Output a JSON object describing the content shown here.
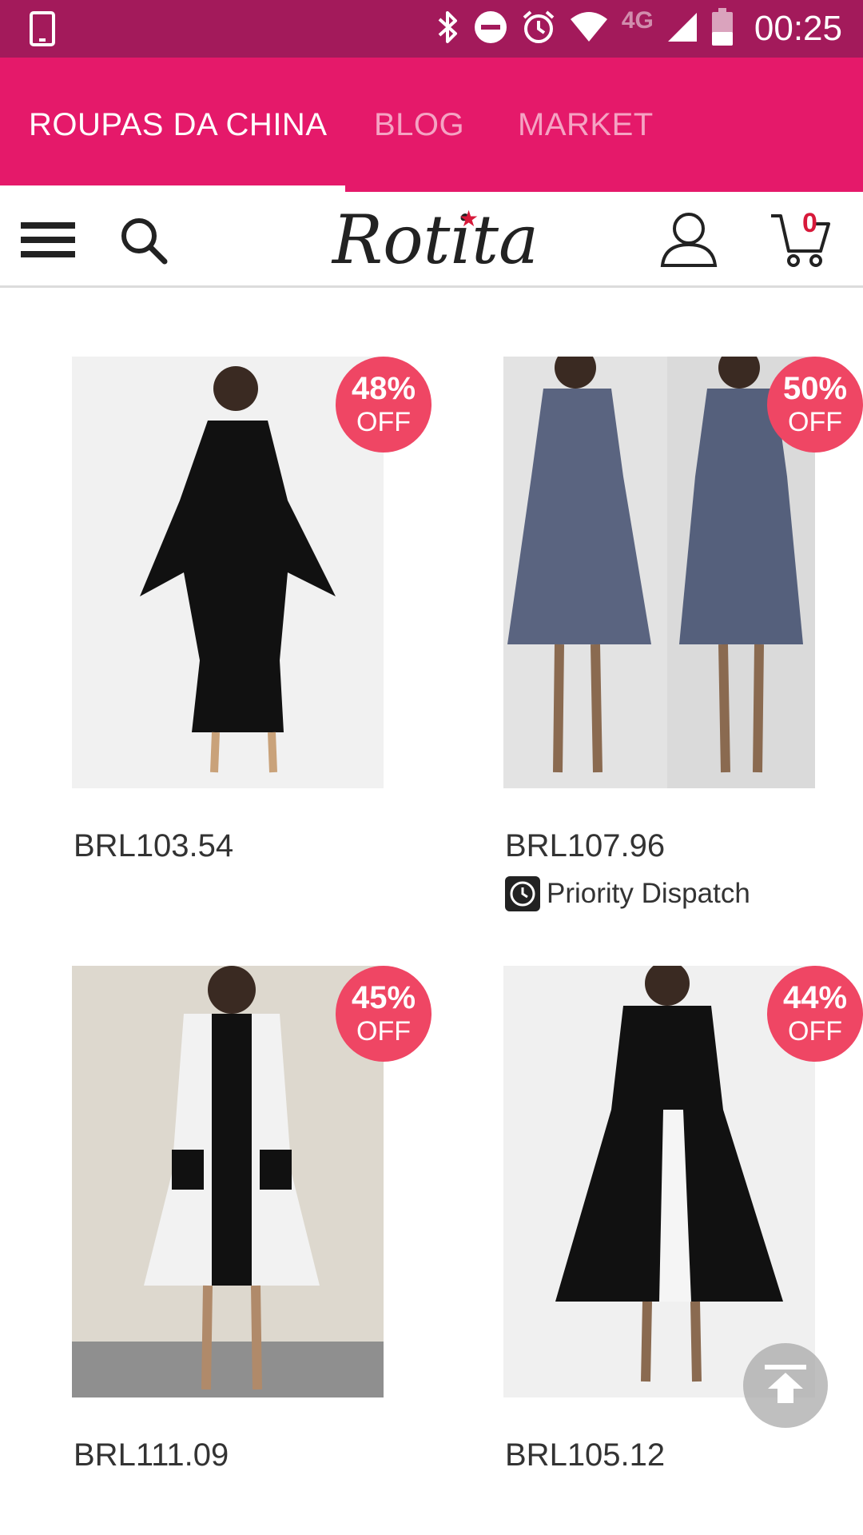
{
  "status_bar": {
    "time": "00:25",
    "network": "4G",
    "icons": [
      "phone-icon",
      "bluetooth-icon",
      "dnd-icon",
      "alarm-icon",
      "wifi-icon",
      "signal-icon",
      "battery-icon"
    ]
  },
  "tabs": [
    {
      "label": "ROUPAS DA CHINA",
      "active": true
    },
    {
      "label": "BLOG",
      "active": false
    },
    {
      "label": "MARKET",
      "active": false
    }
  ],
  "header": {
    "logo_text": "Rotita",
    "cart_count": "0",
    "icons": [
      "menu-icon",
      "search-icon",
      "user-icon",
      "cart-icon"
    ]
  },
  "products": [
    {
      "price": "BRL103.54",
      "discount_pct": "48%",
      "discount_off": "OFF",
      "priority": ""
    },
    {
      "price": "BRL107.96",
      "discount_pct": "50%",
      "discount_off": "OFF",
      "priority": "Priority Dispatch"
    },
    {
      "price": "BRL111.09",
      "discount_pct": "45%",
      "discount_off": "OFF",
      "priority": ""
    },
    {
      "price": "BRL105.12",
      "discount_pct": "44%",
      "discount_off": "OFF",
      "priority": ""
    }
  ],
  "colors": {
    "status_bar": "#a31a5b",
    "tab_bar": "#e5196a",
    "badge": "#ef4664",
    "accent_red": "#d7193a"
  }
}
